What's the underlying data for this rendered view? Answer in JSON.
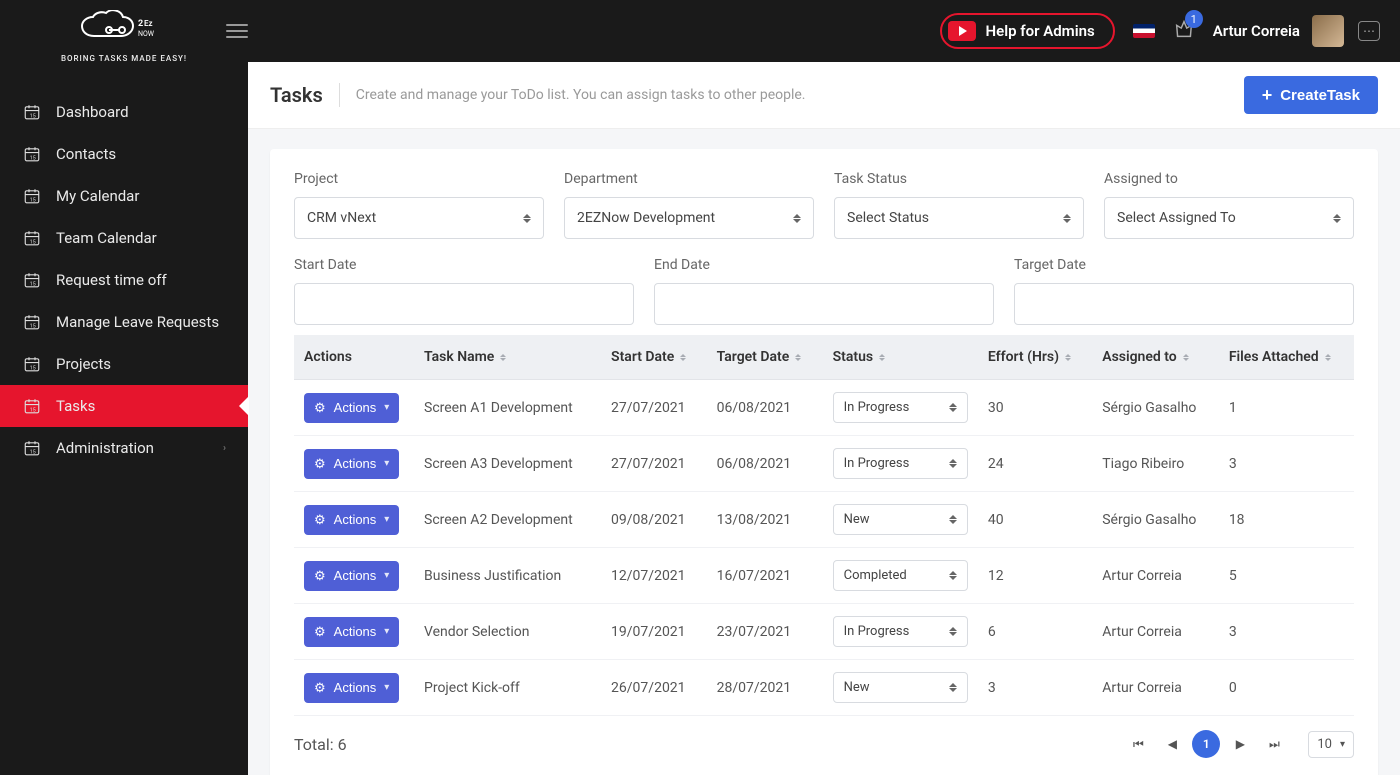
{
  "brand": {
    "tagline": "BORING TASKS MADE EASY!"
  },
  "topbar": {
    "help_label": "Help for Admins",
    "notif_count": "1",
    "user_name": "Artur Correia"
  },
  "sidebar": {
    "items": [
      {
        "label": "Dashboard",
        "has_sub": false
      },
      {
        "label": "Contacts",
        "has_sub": false
      },
      {
        "label": "My Calendar",
        "has_sub": false
      },
      {
        "label": "Team Calendar",
        "has_sub": false
      },
      {
        "label": "Request time off",
        "has_sub": false
      },
      {
        "label": "Manage Leave Requests",
        "has_sub": false
      },
      {
        "label": "Projects",
        "has_sub": false
      },
      {
        "label": "Tasks",
        "has_sub": false
      },
      {
        "label": "Administration",
        "has_sub": true
      }
    ],
    "active_index": 7
  },
  "page": {
    "title": "Tasks",
    "subtitle": "Create and manage your ToDo list. You can assign tasks to other people.",
    "create_label": "CreateTask"
  },
  "filters": {
    "project": {
      "label": "Project",
      "value": "CRM vNext"
    },
    "department": {
      "label": "Department",
      "value": "2EZNow Development"
    },
    "status": {
      "label": "Task Status",
      "value": "Select Status"
    },
    "assigned": {
      "label": "Assigned to",
      "value": "Select Assigned To"
    },
    "start": {
      "label": "Start Date",
      "value": ""
    },
    "end": {
      "label": "End Date",
      "value": ""
    },
    "target": {
      "label": "Target Date",
      "value": ""
    }
  },
  "grid": {
    "columns": {
      "actions": "Actions",
      "task_name": "Task Name",
      "start_date": "Start Date",
      "target_date": "Target Date",
      "status": "Status",
      "effort": "Effort (Hrs)",
      "assigned": "Assigned to",
      "files": "Files Attached"
    },
    "action_btn_label": "Actions",
    "rows": [
      {
        "name": "Screen A1 Development",
        "start": "27/07/2021",
        "target": "06/08/2021",
        "status": "In Progress",
        "effort": "30",
        "assigned": "Sérgio Gasalho",
        "files": "1"
      },
      {
        "name": "Screen A3 Development",
        "start": "27/07/2021",
        "target": "06/08/2021",
        "status": "In Progress",
        "effort": "24",
        "assigned": "Tiago Ribeiro",
        "files": "3"
      },
      {
        "name": "Screen A2 Development",
        "start": "09/08/2021",
        "target": "13/08/2021",
        "status": "New",
        "effort": "40",
        "assigned": "Sérgio Gasalho",
        "files": "18"
      },
      {
        "name": "Business Justification",
        "start": "12/07/2021",
        "target": "16/07/2021",
        "status": "Completed",
        "effort": "12",
        "assigned": "Artur Correia",
        "files": "5"
      },
      {
        "name": "Vendor Selection",
        "start": "19/07/2021",
        "target": "23/07/2021",
        "status": "In Progress",
        "effort": "6",
        "assigned": "Artur Correia",
        "files": "3"
      },
      {
        "name": "Project Kick-off",
        "start": "26/07/2021",
        "target": "28/07/2021",
        "status": "New",
        "effort": "3",
        "assigned": "Artur Correia",
        "files": "0"
      }
    ],
    "total_label": "Total: 6",
    "page_current": "1",
    "page_size": "10"
  }
}
